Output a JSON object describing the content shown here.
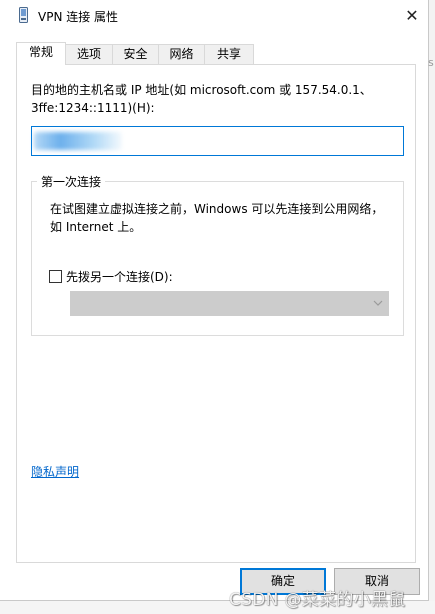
{
  "window": {
    "title": "VPN 连接 属性",
    "close_glyph": "✕"
  },
  "tabs": [
    {
      "label": "常规",
      "active": true
    },
    {
      "label": "选项",
      "active": false
    },
    {
      "label": "安全",
      "active": false
    },
    {
      "label": "网络",
      "active": false
    },
    {
      "label": "共享",
      "active": false
    }
  ],
  "general": {
    "host_label_line1": "目的地的主机名或 IP 地址(如 microsoft.com 或 157.54.0.1、",
    "host_label_line2": "3ffe:1234::1111)(H):",
    "host_value_redacted": true,
    "first_connect": {
      "title": "第一次连接",
      "desc_line1": "在试图建立虚拟连接之前，Windows 可以先连接到公用网络，",
      "desc_line2": "如 Internet 上。",
      "checkbox_label": "先拨另一个连接(D):",
      "checkbox_checked": false,
      "select_value": "",
      "select_enabled": false
    }
  },
  "privacy_link": "隐私声明",
  "buttons": {
    "ok": "确定",
    "cancel": "取消"
  },
  "watermark": "CSDN @菜菜的小黑鼠",
  "icons": {
    "app": "vpn-phone-icon",
    "close": "close-icon",
    "dropdown": "chevron-down-icon"
  },
  "colors": {
    "accent": "#0078d7",
    "link": "#0066cc",
    "disabled_select": "#cccccc"
  }
}
